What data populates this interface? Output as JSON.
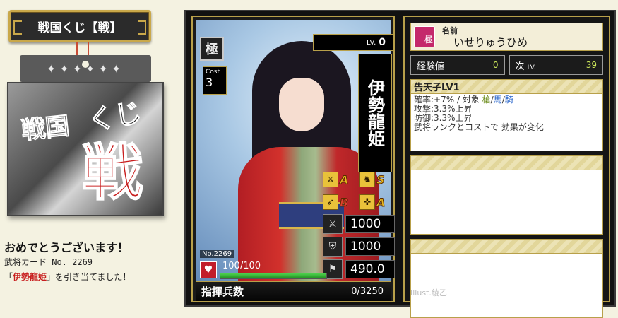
{
  "banner": {
    "title": "戦国くじ【戦】"
  },
  "ticket": {
    "top_text": "✦✦✦✦✦✦",
    "text_senkoku": "戦国",
    "text_kuji": "くじ",
    "text_ikusa": "戦"
  },
  "result": {
    "congrats": "おめでとうございます！",
    "card_line": "武将カード No. 2269",
    "open_quote": "「",
    "card_name": "伊勢龍姫",
    "close_text": "」を引き当てました！"
  },
  "card": {
    "rank": "極",
    "lv_label": "LV.",
    "lv": "0",
    "cost_label": "Cost",
    "cost": "3",
    "name": "伊勢龍姫",
    "aptitudes": [
      {
        "icon": "spear-icon",
        "glyph": "⚔",
        "rank": "A"
      },
      {
        "icon": "horse-icon",
        "glyph": "♞",
        "rank": "S"
      },
      {
        "icon": "bow-icon",
        "glyph": "➶",
        "rank": "B"
      },
      {
        "icon": "gun-icon",
        "glyph": "✜",
        "rank": "A"
      }
    ],
    "stats": {
      "attack": "1000",
      "defense": "1000",
      "speed": "490.0"
    },
    "no_label": "No.",
    "no": "2269",
    "hp_text": "100/100",
    "hp_fraction": 1.0,
    "command_label": "指揮兵数",
    "command_value": "0/3250"
  },
  "info": {
    "name_icon_text": "極",
    "name_label": "名前",
    "name_reading": "いせりゅうひめ",
    "exp_label": "経験値",
    "exp_value": "0",
    "next_label": "次",
    "next_lv_label": "LV.",
    "next_value": "39",
    "skill_title": "告天子LV1",
    "skill_line1_a": "確率:+7%  /  対象  ",
    "skill_target1": "槍",
    "skill_sep1": "/",
    "skill_target2": "馬",
    "skill_sep2": "/",
    "skill_target3": "騎",
    "skill_line2": "攻撃:3.3%上昇",
    "skill_line3": "防御:3.3%上昇",
    "skill_line4": "武将ランクとコストで 効果が変化",
    "illust": "Illust.綾乙"
  },
  "colors": {
    "background": "#f4f2e1",
    "gold": "#b8a04a",
    "accent_red": "#c81e1e",
    "hp_green": "#3ac03a"
  }
}
